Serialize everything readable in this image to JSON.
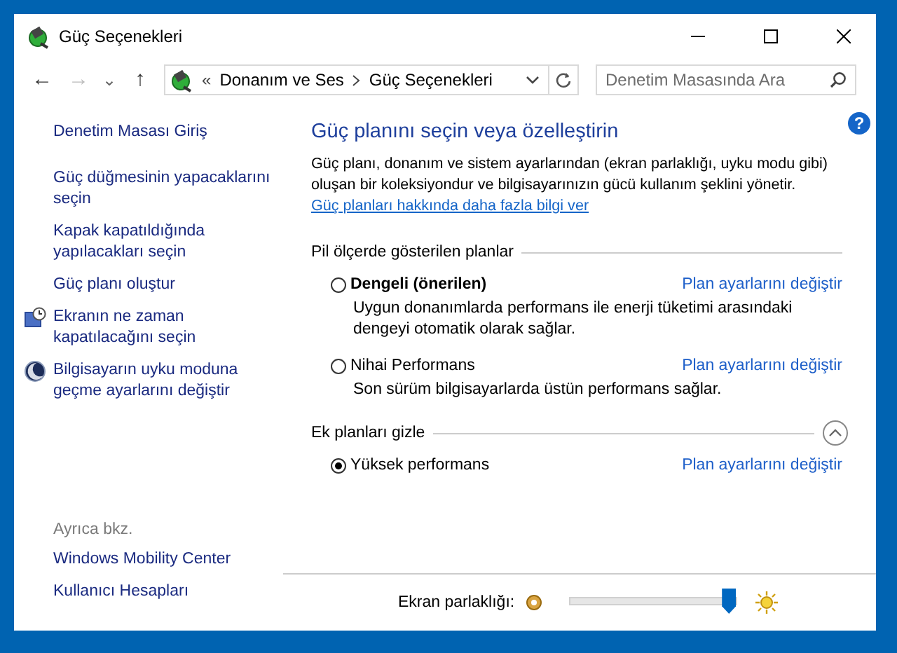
{
  "window": {
    "title": "Güç Seçenekleri"
  },
  "nav": {
    "back": "←",
    "forward": "→",
    "forward_disabled": true,
    "up": "↑",
    "history": "⌄",
    "prefix": "«",
    "breadcrumbs": [
      "Donanım ve Ses",
      "Güç Seçenekleri"
    ],
    "search": {
      "placeholder": "Denetim Masasında Ara"
    }
  },
  "help": "?",
  "sidebar": {
    "home": "Denetim Masası Giriş",
    "links": [
      {
        "label": "Güç düğmesinin yapacaklarını seçin",
        "kind": "plain"
      },
      {
        "label": "Kapak kapatıldığında yapılacakları seçin",
        "kind": "plain"
      },
      {
        "label": "Güç planı oluştur",
        "kind": "plain"
      },
      {
        "label": "Ekranın ne zaman kapatılacağını seçin",
        "kind": "display"
      },
      {
        "label": "Bilgisayarın uyku moduna geçme ayarlarını değiştir",
        "kind": "sleep"
      }
    ],
    "see_also": {
      "heading": "Ayrıca bkz.",
      "links": [
        "Windows Mobility Center",
        "Kullanıcı Hesapları"
      ]
    }
  },
  "main": {
    "heading": "Güç planını seçin veya özelleştirin",
    "description": "Güç planı, donanım ve sistem ayarlarından (ekran parlaklığı, uyku modu gibi) oluşan bir koleksiyondur ve bilgisayarınızın gücü kullanım şeklini yönetir.",
    "link": "Güç planları hakkında daha fazla bilgi ver",
    "groups": [
      {
        "title": "Pil ölçerde gösterilen planlar",
        "kind": "fixed",
        "plans": [
          {
            "name": "Dengeli (önerilen)",
            "bold": true,
            "selected": false,
            "link": "Plan ayarlarını değiştir",
            "description": "Uygun donanımlarda performans ile enerji tüketimi arasındaki dengeyi otomatik olarak sağlar."
          },
          {
            "name": "Nihai Performans",
            "bold": false,
            "selected": false,
            "link": "Plan ayarlarını değiştir",
            "description": "Son sürüm bilgisayarlarda üstün performans sağlar."
          }
        ]
      },
      {
        "title": "Ek planları gizle",
        "kind": "collapsible",
        "expanded": true,
        "plans": [
          {
            "name": "Yüksek performans",
            "bold": false,
            "selected": true,
            "link": "Plan ayarlarını değiştir"
          }
        ]
      }
    ]
  },
  "footer": {
    "brightness": {
      "label": "Ekran parlaklığı:",
      "level": 0.95
    }
  }
}
